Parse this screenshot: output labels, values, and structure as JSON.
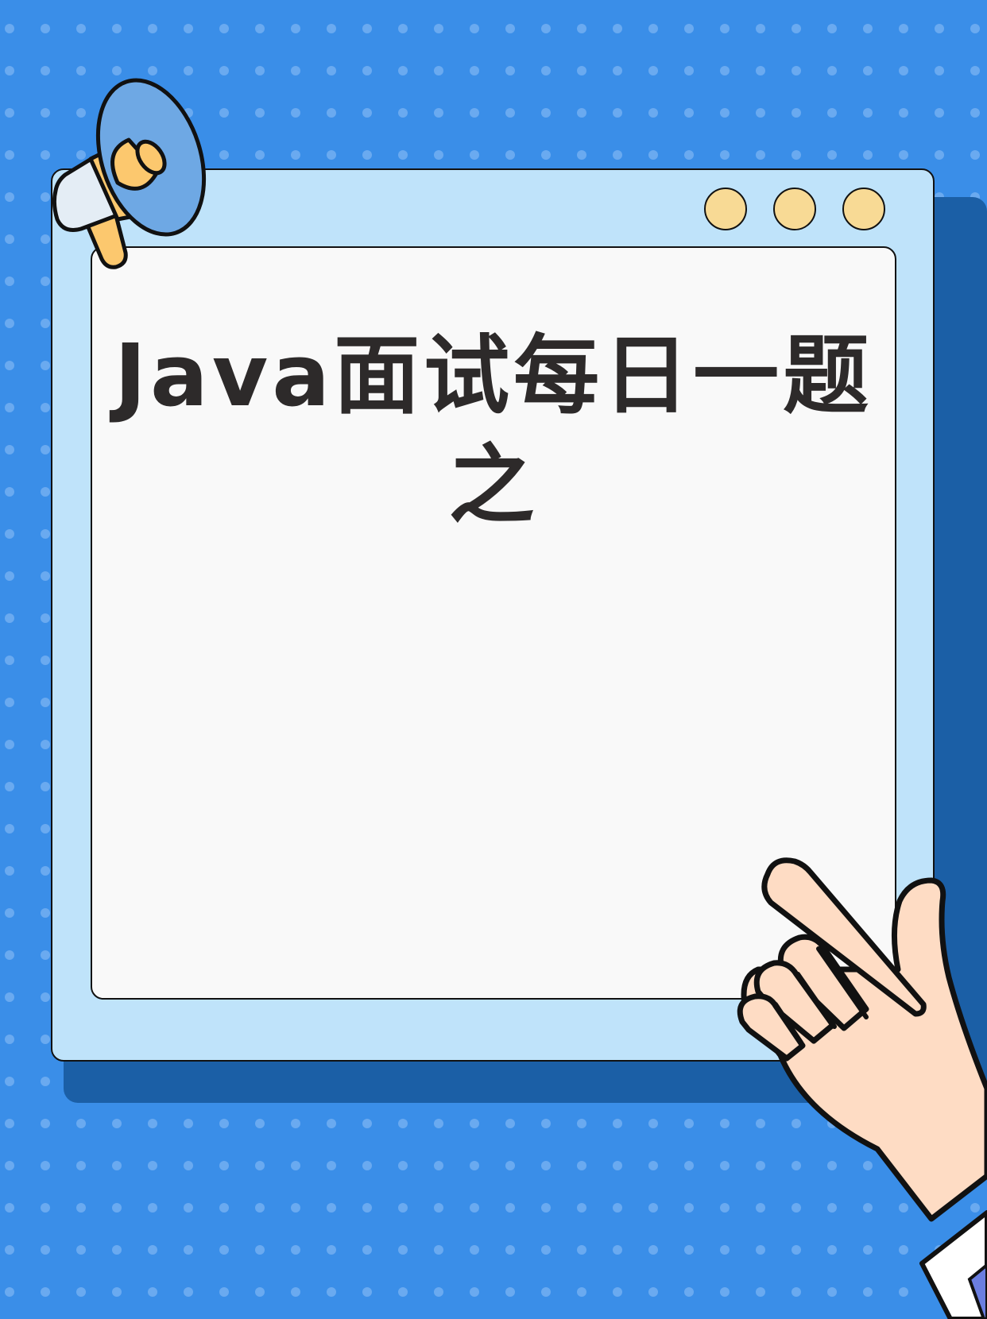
{
  "title": {
    "line1": "Java面试每日一题",
    "line2": "之"
  },
  "colors": {
    "background": "#3a8ee8",
    "background_dots": "#6aaaf0",
    "window_frame": "#bfe3fa",
    "window_shadow": "#1b5fa6",
    "content_panel": "#f9f9f9",
    "title_text": "#2d2a2a",
    "window_dots": "#f8da95",
    "hand_skin": "#fedcc4",
    "megaphone_blue": "#6ea8e4",
    "megaphone_orange": "#fcc86e"
  },
  "icons": [
    "megaphone-icon",
    "pointing-hand-icon"
  ]
}
